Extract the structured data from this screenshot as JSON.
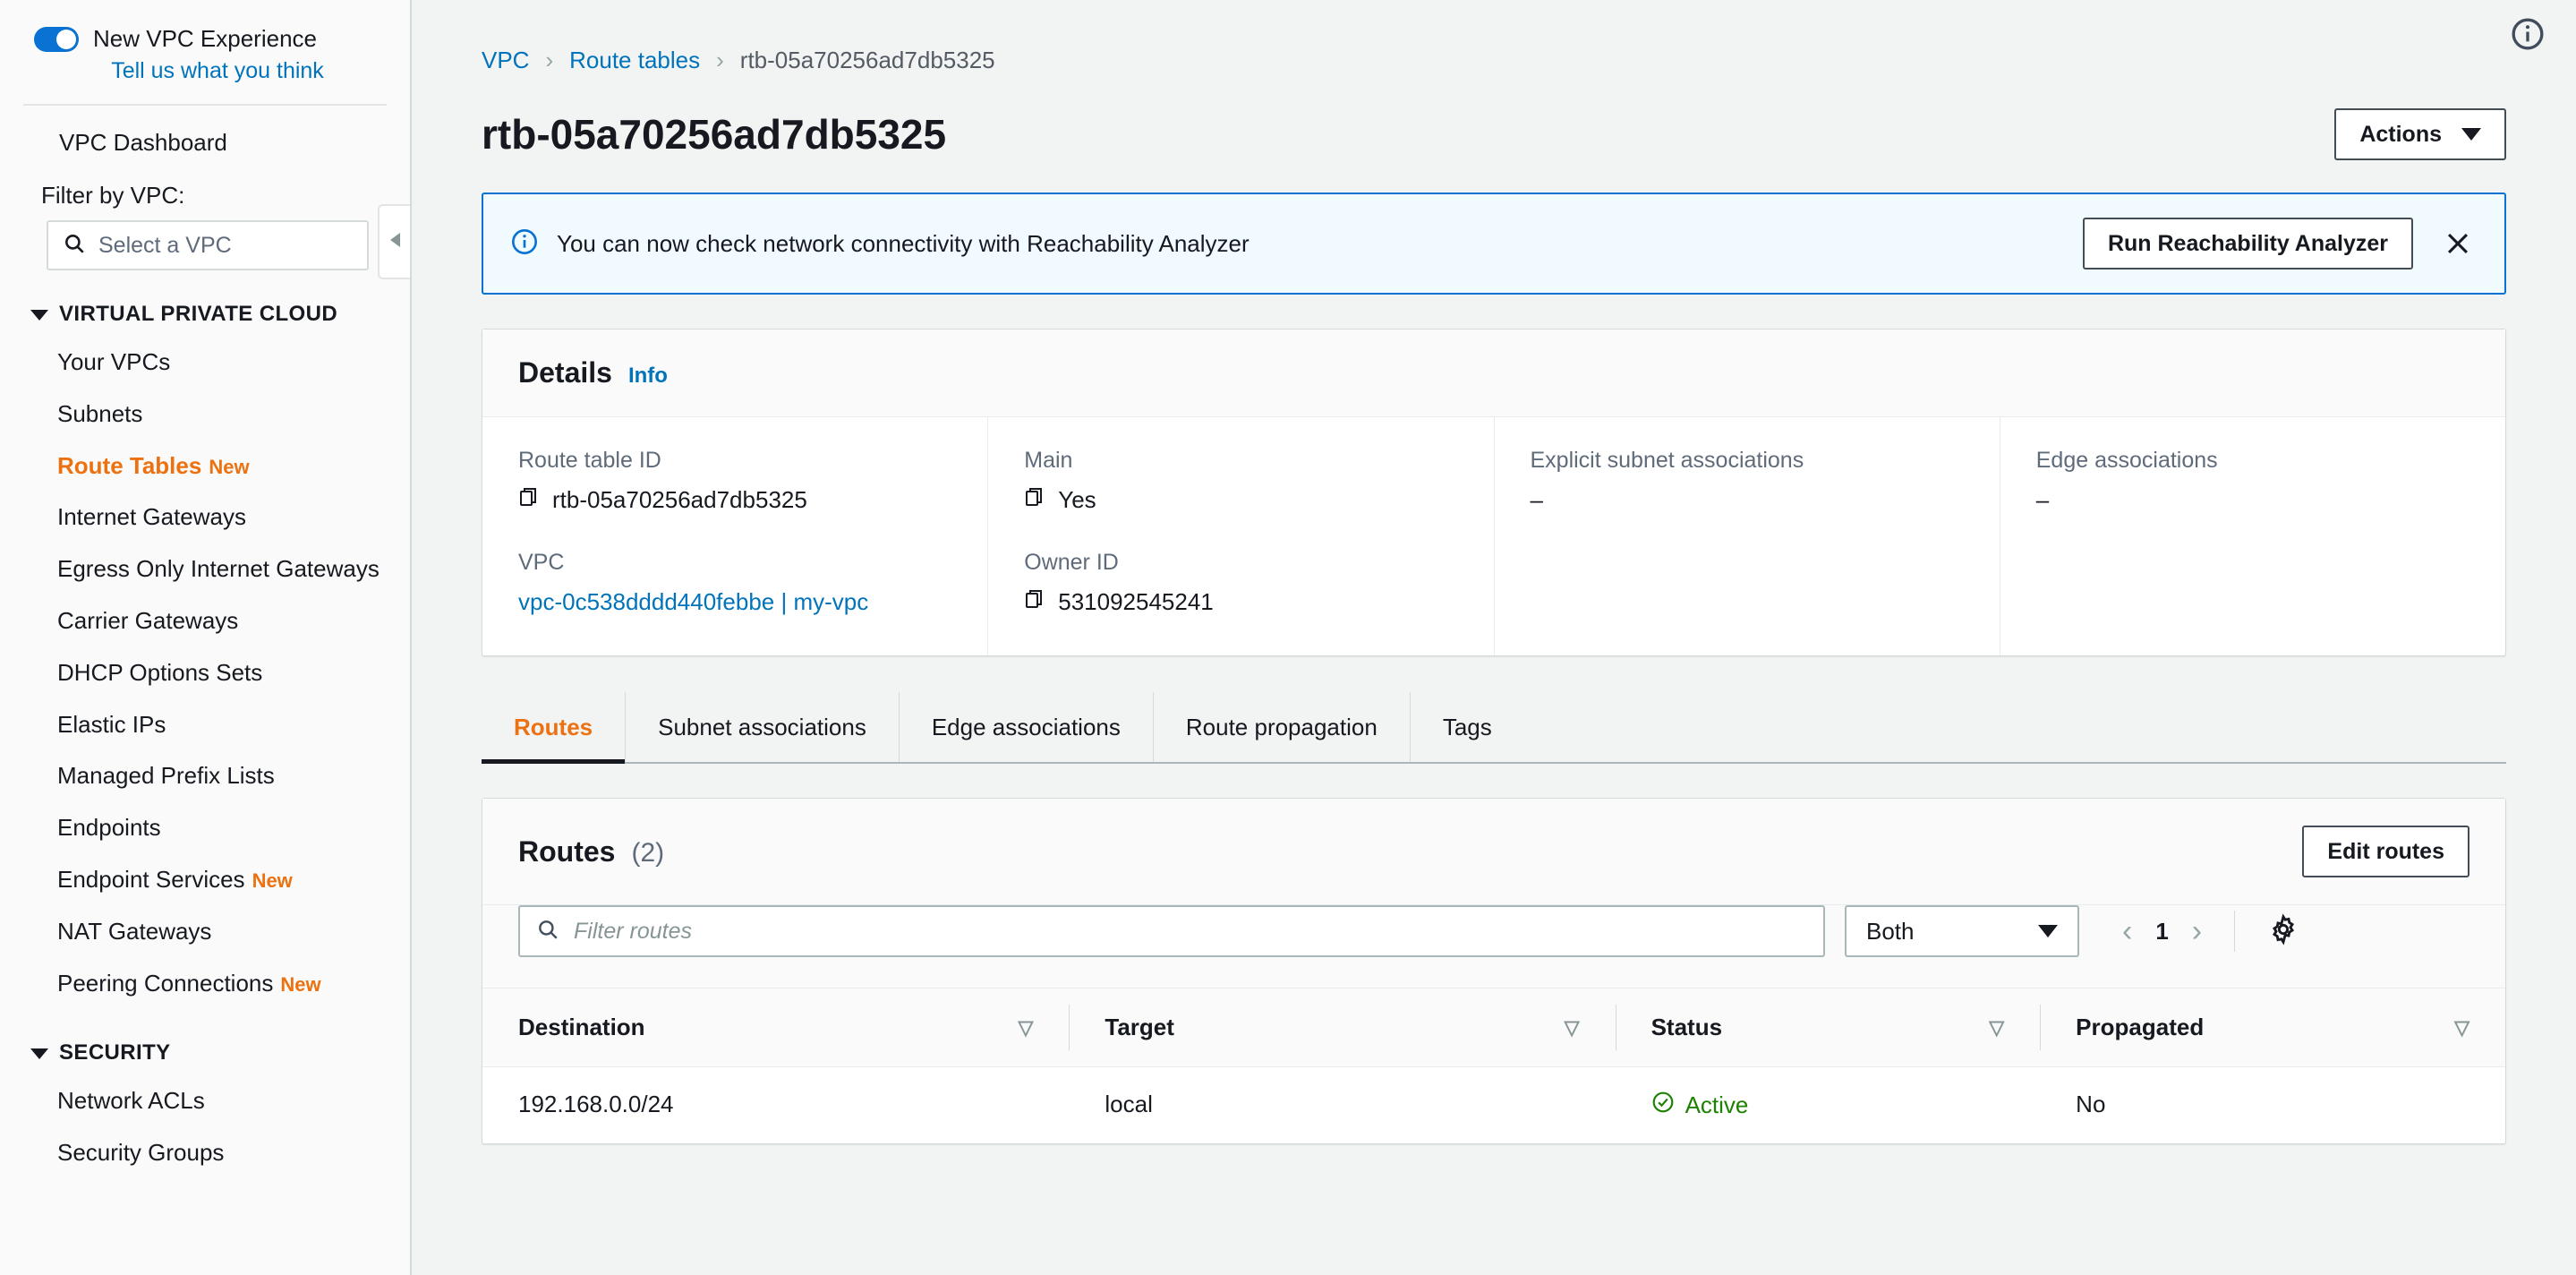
{
  "sidebar": {
    "toggle": {
      "label": "New VPC Experience",
      "enabled": true,
      "feedback_link": "Tell us what you think"
    },
    "dashboard_label": "VPC Dashboard",
    "filter_label": "Filter by VPC:",
    "vpc_select_placeholder": "Select a VPC",
    "groups": [
      {
        "title": "VIRTUAL PRIVATE CLOUD",
        "items": [
          {
            "label": "Your VPCs",
            "badge": "",
            "active": false
          },
          {
            "label": "Subnets",
            "badge": "",
            "active": false
          },
          {
            "label": "Route Tables",
            "badge": "New",
            "active": true
          },
          {
            "label": "Internet Gateways",
            "badge": "",
            "active": false
          },
          {
            "label": "Egress Only Internet Gateways",
            "badge": "",
            "active": false
          },
          {
            "label": "Carrier Gateways",
            "badge": "",
            "active": false
          },
          {
            "label": "DHCP Options Sets",
            "badge": "",
            "active": false
          },
          {
            "label": "Elastic IPs",
            "badge": "",
            "active": false
          },
          {
            "label": "Managed Prefix Lists",
            "badge": "",
            "active": false
          },
          {
            "label": "Endpoints",
            "badge": "",
            "active": false
          },
          {
            "label": "Endpoint Services",
            "badge": "New",
            "active": false
          },
          {
            "label": "NAT Gateways",
            "badge": "",
            "active": false
          },
          {
            "label": "Peering Connections",
            "badge": "New",
            "active": false
          }
        ]
      },
      {
        "title": "SECURITY",
        "items": [
          {
            "label": "Network ACLs",
            "badge": "",
            "active": false
          },
          {
            "label": "Security Groups",
            "badge": "",
            "active": false
          }
        ]
      }
    ]
  },
  "breadcrumb": {
    "root": "VPC",
    "parent": "Route tables",
    "current": "rtb-05a70256ad7db5325",
    "separator": "›"
  },
  "header": {
    "title": "rtb-05a70256ad7db5325",
    "actions_label": "Actions"
  },
  "banner": {
    "message": "You can now check network connectivity with Reachability Analyzer",
    "button_label": "Run Reachability Analyzer"
  },
  "details": {
    "title": "Details",
    "info_label": "Info",
    "columns": [
      {
        "fields": [
          {
            "label": "Route table ID",
            "value": "rtb-05a70256ad7db5325",
            "copyable": true,
            "link": false
          },
          {
            "label": "VPC",
            "value": "vpc-0c538dddd440febbe | my-vpc",
            "copyable": false,
            "link": true
          }
        ]
      },
      {
        "fields": [
          {
            "label": "Main",
            "value": "Yes",
            "copyable": true,
            "link": false
          },
          {
            "label": "Owner ID",
            "value": "531092545241",
            "copyable": true,
            "link": false
          }
        ]
      },
      {
        "fields": [
          {
            "label": "Explicit subnet associations",
            "value": "–",
            "copyable": false,
            "link": false
          }
        ]
      },
      {
        "fields": [
          {
            "label": "Edge associations",
            "value": "–",
            "copyable": false,
            "link": false
          }
        ]
      }
    ]
  },
  "tabs": [
    {
      "label": "Routes",
      "active": true
    },
    {
      "label": "Subnet associations",
      "active": false
    },
    {
      "label": "Edge associations",
      "active": false
    },
    {
      "label": "Route propagation",
      "active": false
    },
    {
      "label": "Tags",
      "active": false
    }
  ],
  "routes_panel": {
    "title": "Routes",
    "count": "(2)",
    "edit_label": "Edit routes",
    "search_placeholder": "Filter routes",
    "filter_select_value": "Both",
    "page_number": "1",
    "columns": [
      "Destination",
      "Target",
      "Status",
      "Propagated"
    ],
    "rows": [
      {
        "destination": "192.168.0.0/24",
        "target": "local",
        "status": "Active",
        "propagated": "No"
      }
    ]
  },
  "colors": {
    "accent_orange": "#ec7211",
    "link_blue": "#0073bb",
    "banner_blue": "#0972d3",
    "status_green": "#1d8102"
  }
}
